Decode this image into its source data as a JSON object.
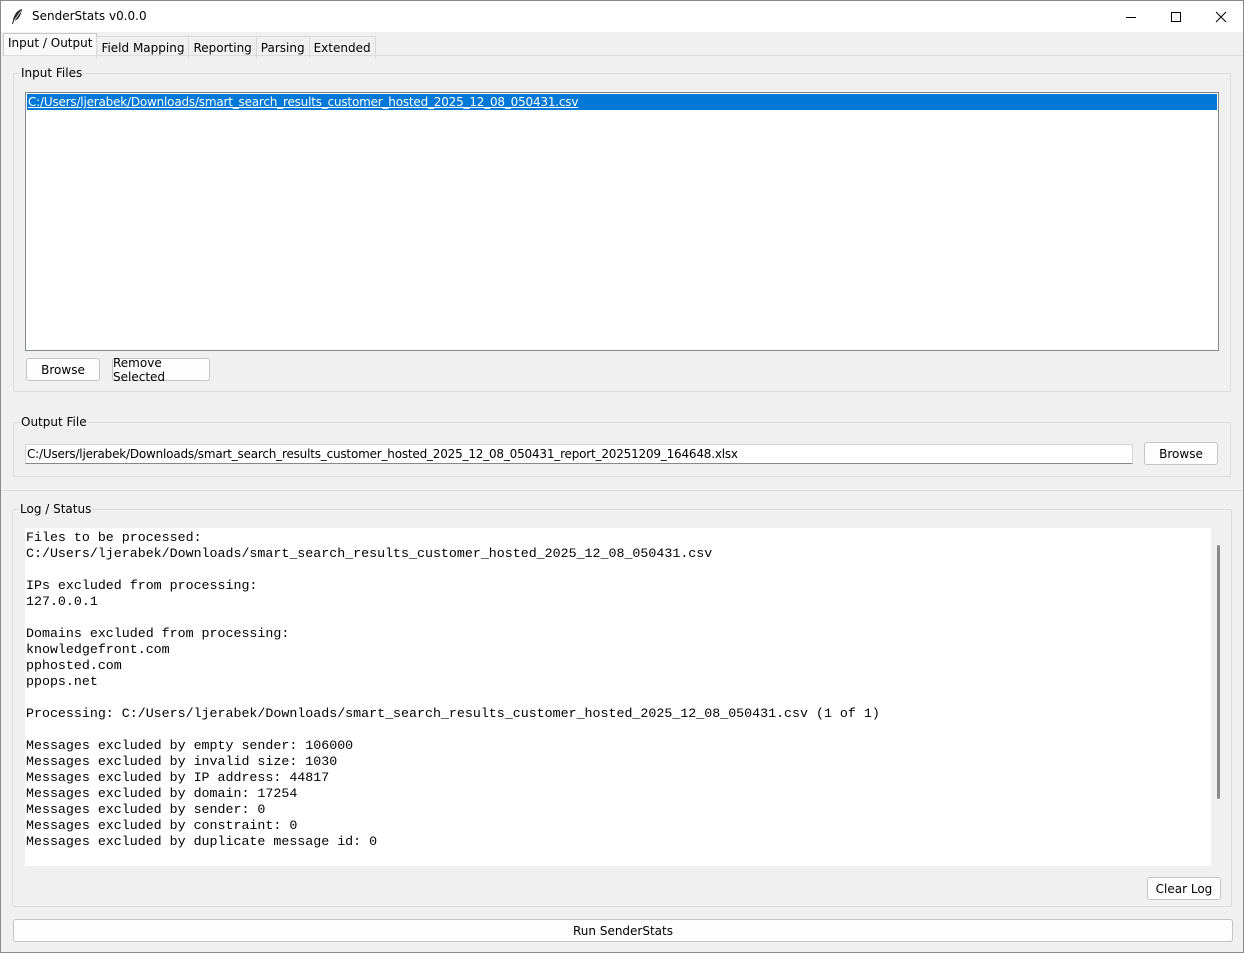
{
  "window": {
    "title": "SenderStats v0.0.0",
    "controls": {
      "minimize": "minimize-icon",
      "maximize": "maximize-icon",
      "close": "close-icon"
    }
  },
  "tabs": [
    {
      "label": "Input / Output",
      "active": true
    },
    {
      "label": "Field Mapping",
      "active": false
    },
    {
      "label": "Reporting",
      "active": false
    },
    {
      "label": "Parsing",
      "active": false
    },
    {
      "label": "Extended",
      "active": false
    }
  ],
  "input_files": {
    "label": "Input Files",
    "items": [
      "C:/Users/ljerabek/Downloads/smart_search_results_customer_hosted_2025_12_08_050431.csv"
    ],
    "browse_label": "Browse",
    "remove_label": "Remove Selected"
  },
  "output_file": {
    "label": "Output File",
    "value": "C:/Users/ljerabek/Downloads/smart_search_results_customer_hosted_2025_12_08_050431_report_20251209_164648.xlsx",
    "browse_label": "Browse"
  },
  "log": {
    "label": "Log / Status",
    "lines": [
      "Files to be processed:",
      "C:/Users/ljerabek/Downloads/smart_search_results_customer_hosted_2025_12_08_050431.csv",
      "",
      "IPs excluded from processing:",
      "127.0.0.1",
      "",
      "Domains excluded from processing:",
      "knowledgefront.com",
      "pphosted.com",
      "ppops.net",
      "",
      "Processing: C:/Users/ljerabek/Downloads/smart_search_results_customer_hosted_2025_12_08_050431.csv (1 of 1)",
      "",
      "Messages excluded by empty sender: 106000",
      "Messages excluded by invalid size: 1030",
      "Messages excluded by IP address: 44817",
      "Messages excluded by domain: 17254",
      "Messages excluded by sender: 0",
      "Messages excluded by constraint: 0",
      "Messages excluded by duplicate message id: 0"
    ],
    "clear_label": "Clear Log"
  },
  "run_label": "Run SenderStats",
  "colors": {
    "selection": "#0078d7",
    "background": "#f0f0f0"
  }
}
